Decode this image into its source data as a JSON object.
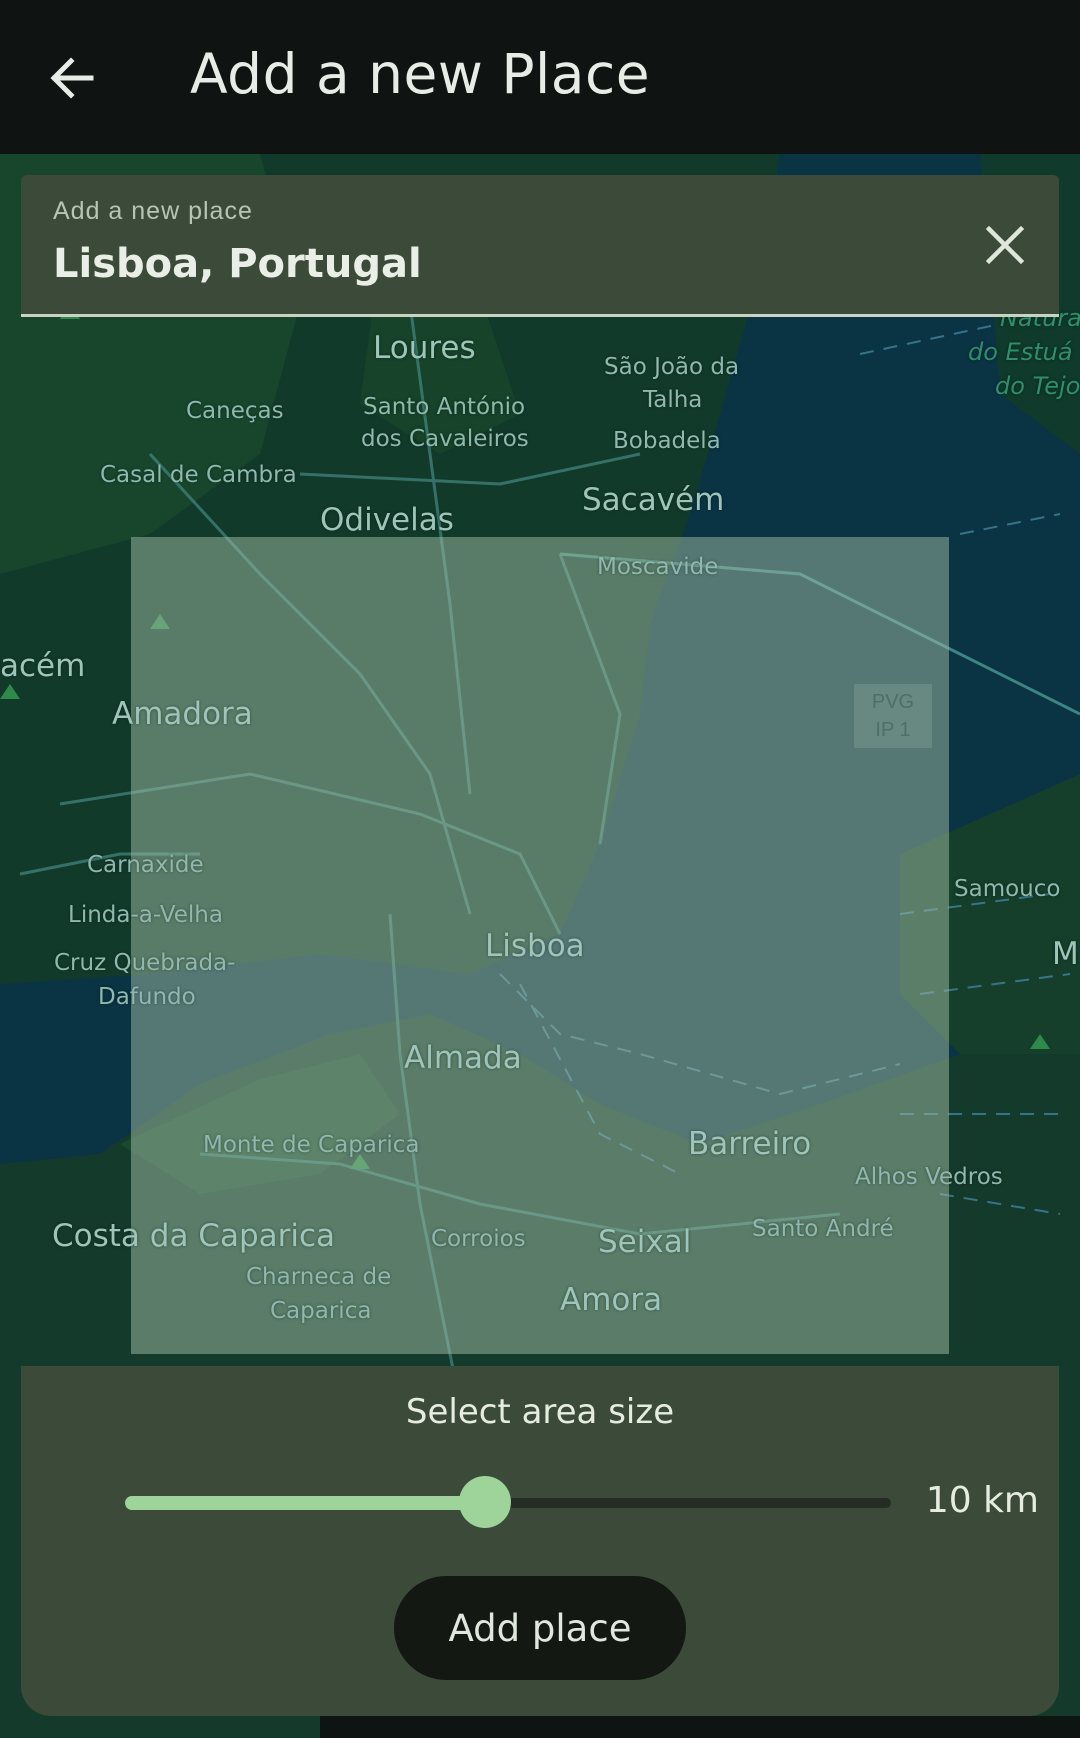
{
  "appbar": {
    "title": "Add a new Place",
    "back_icon": "arrow-left-icon"
  },
  "search": {
    "label": "Add a new place",
    "value": "Lisboa, Portugal",
    "clear_icon": "close-icon"
  },
  "map": {
    "labels": {
      "loures": "Loures",
      "sao_joao": "São João da",
      "talha": "Talha",
      "canecas": "Caneças",
      "santo_antonio": "Santo António",
      "dos_cavaleiros": "dos Cavaleiros",
      "bobadela": "Bobadela",
      "casal_de_cambra": "Casal de Cambra",
      "odivelas": "Odivelas",
      "sacavem": "Sacavém",
      "moscavide": "Moscavide",
      "amadora": "Amadora",
      "acem": "acém",
      "carnaxide": "Carnaxide",
      "linda_a_velha": "Linda-a-Velha",
      "cruz_quebrada": "Cruz Quebrada-",
      "dafundo": "Dafundo",
      "lisboa": "Lisboa",
      "samouco": "Samouco",
      "almada": "Almada",
      "monte_de_caparica": "Monte de Caparica",
      "barreiro": "Barreiro",
      "alhos_vedros": "Alhos Vedros",
      "costa_da_caparica": "Costa da Caparica",
      "corroios": "Corroios",
      "seixal": "Seixal",
      "santo_andre": "Santo André",
      "charneca_de": "Charneca de",
      "caparica": "Caparica",
      "amora": "Amora",
      "nature_1": "Natura",
      "nature_2": "do Estuá",
      "nature_3": "do Tejo",
      "m_cut": "M",
      "pvg_line1": "PVG",
      "pvg_line2": "IP 1"
    },
    "area_color": "#a0bea5"
  },
  "panel": {
    "title": "Select area size",
    "slider_value_label": "10 km",
    "slider_fraction": 0.47,
    "add_button_label": "Add place",
    "accent": "#9ed39a"
  }
}
